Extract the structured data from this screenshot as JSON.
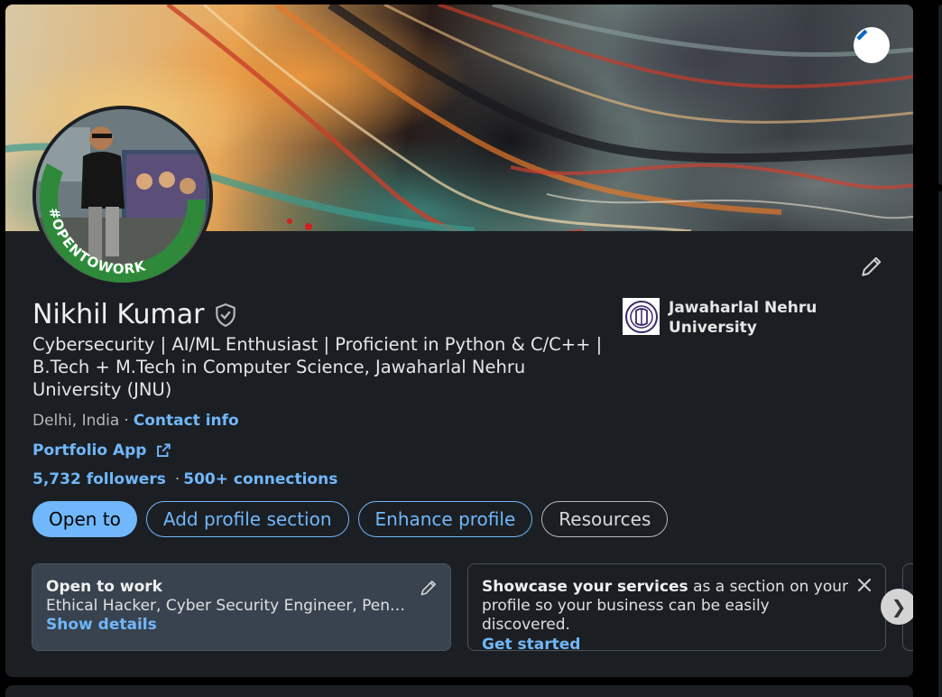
{
  "profile": {
    "name": "Nikhil Kumar",
    "headline": "Cybersecurity | AI/ML Enthusiast | Proficient in Python & C/C++ | B.Tech + M.Tech in Computer Science, Jawaharlal Nehru University (JNU)",
    "location": "Delhi, India",
    "separator": "·",
    "contact_info": "Contact info",
    "portfolio_link": "Portfolio App",
    "followers": "5,732 followers",
    "stats_separator": "·",
    "connections": "500+ connections",
    "avatar_badge": "#OPENTOWORK"
  },
  "education": {
    "school": "Jawaharlal Nehru University"
  },
  "buttons": {
    "open_to": "Open to",
    "add_section": "Add profile section",
    "enhance": "Enhance profile",
    "resources": "Resources"
  },
  "open_to_work": {
    "title": "Open to work",
    "roles": "Ethical Hacker, Cyber Security Engineer, Penetration Tester",
    "link": "Show details"
  },
  "services": {
    "bold": "Showcase your services",
    "text": " as a section on your profile so your business can be easily discovered.",
    "link": "Get started"
  },
  "icons": {
    "banner_edit": "pencil-icon",
    "intro_edit": "pencil-icon",
    "verified": "shield-check-icon",
    "external": "external-link-icon",
    "close": "close-icon",
    "next": "chevron-right-icon"
  },
  "next_glyph": "❯",
  "colors": {
    "background": "#000000",
    "card": "#1b1f23",
    "accent": "#71b7fb",
    "open_to_work_green": "#2e8a3a"
  }
}
